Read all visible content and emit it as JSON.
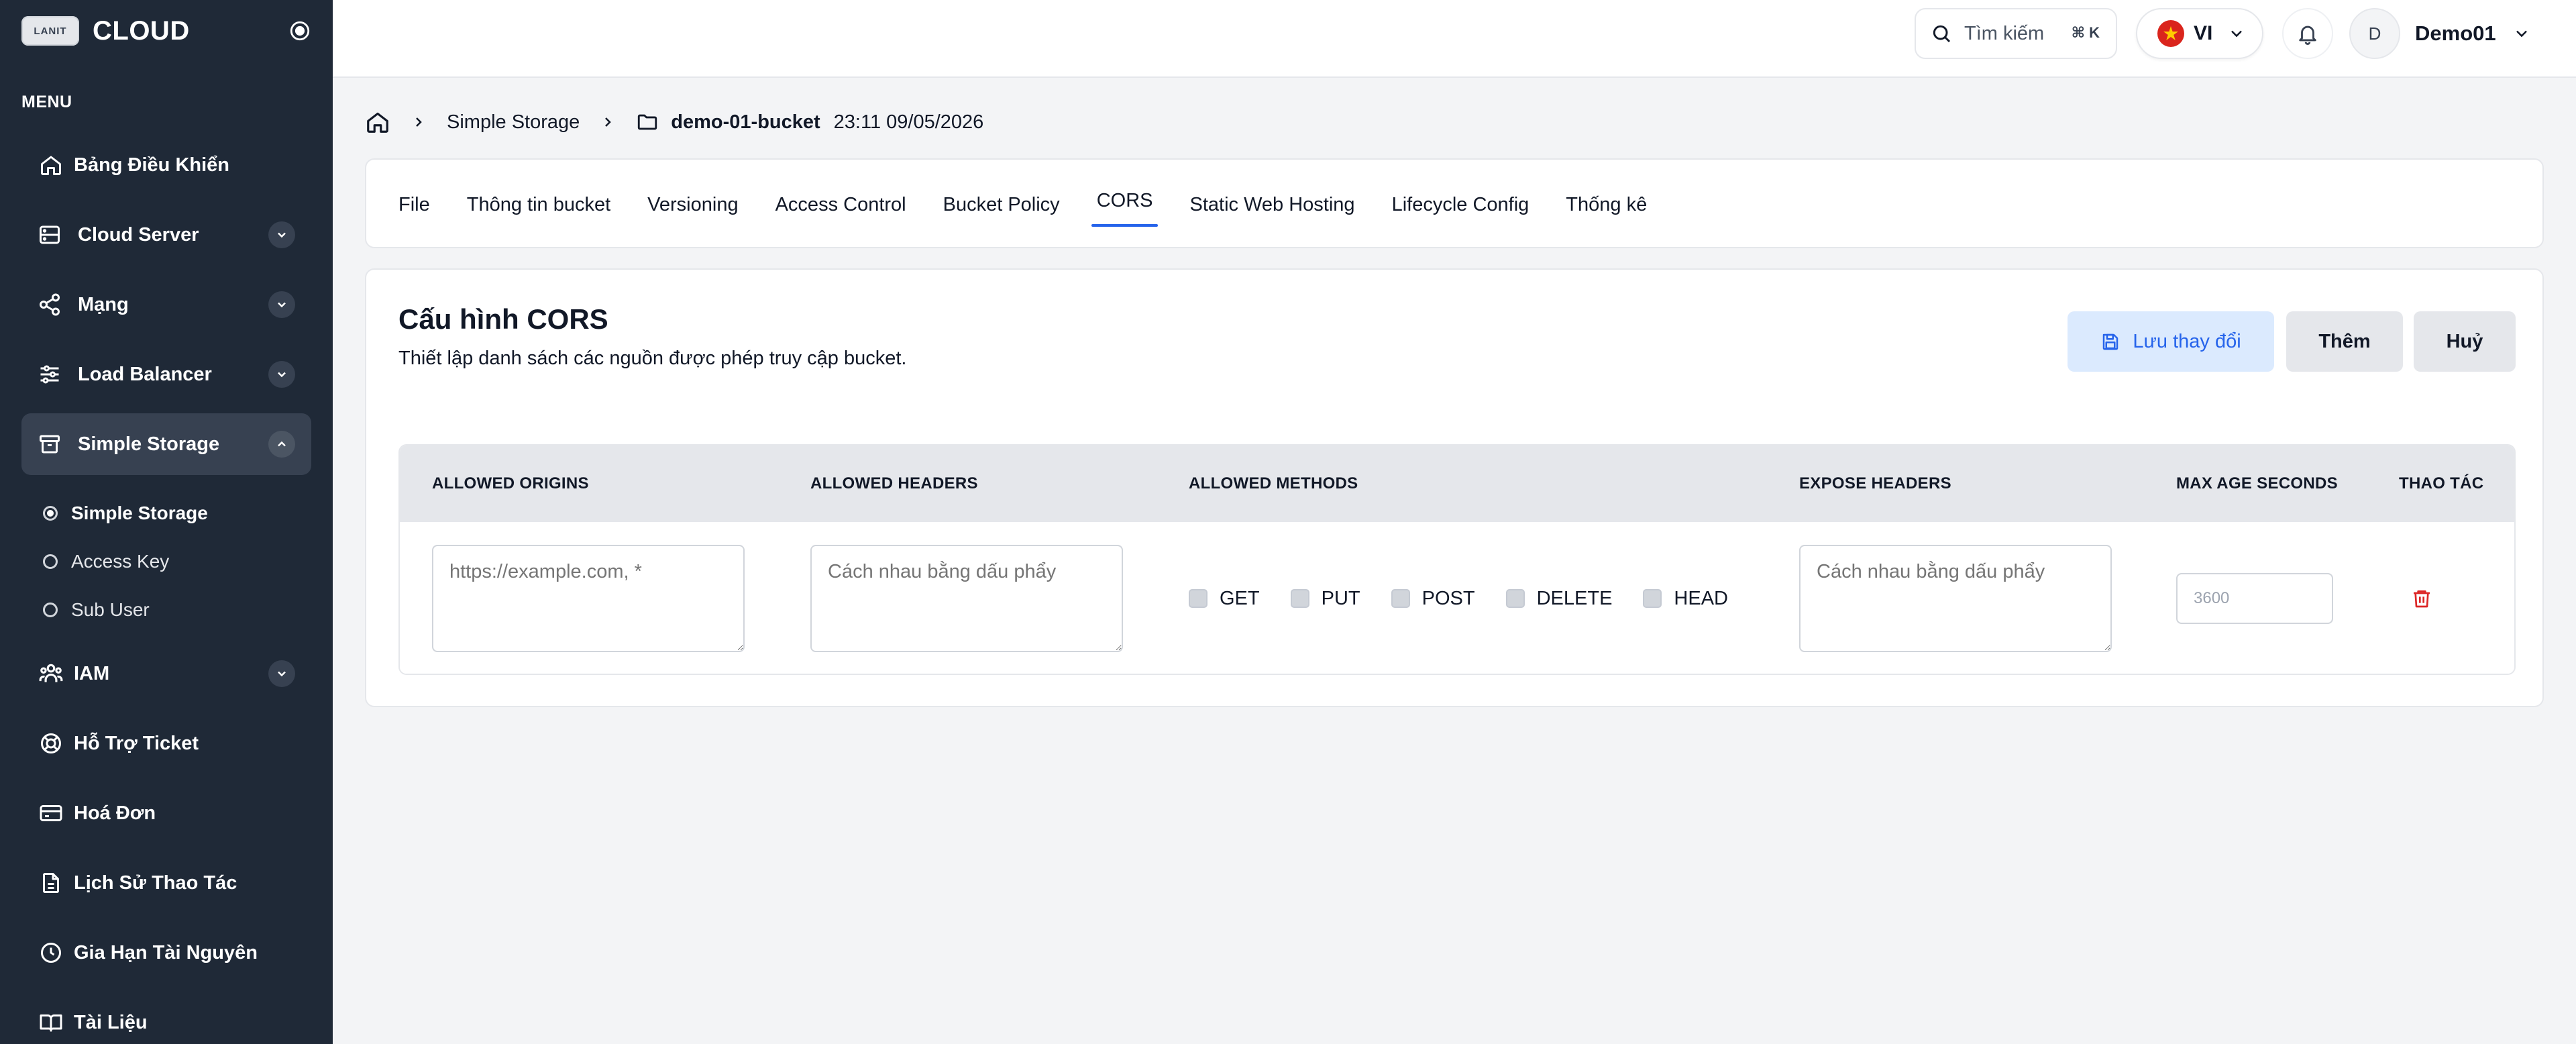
{
  "brand": {
    "logo_text": "LANIT",
    "name": "CLOUD"
  },
  "sidebar": {
    "menu_heading": "MENU",
    "items": [
      {
        "label": "Bảng Điều Khiển",
        "icon": "home-icon"
      },
      {
        "label": "Cloud Server",
        "icon": "server-icon",
        "expandable": true
      },
      {
        "label": "Mạng",
        "icon": "network-share-icon",
        "expandable": true
      },
      {
        "label": "Load Balancer",
        "icon": "sliders-icon",
        "expandable": true
      },
      {
        "label": "Simple Storage",
        "icon": "archive-box-icon",
        "expandable": true,
        "expanded": true,
        "active": true
      },
      {
        "label": "IAM",
        "icon": "users-group-icon",
        "expandable": true
      },
      {
        "label": "Hỗ Trợ Ticket",
        "icon": "lifebuoy-icon"
      },
      {
        "label": "Hoá Đơn",
        "icon": "credit-card-icon"
      },
      {
        "label": "Lịch Sử Thao Tác",
        "icon": "document-icon"
      },
      {
        "label": "Gia Hạn Tài Nguyên",
        "icon": "clock-icon"
      },
      {
        "label": "Tài Liệu",
        "icon": "book-icon"
      }
    ],
    "storage_subitems": [
      {
        "label": "Simple Storage",
        "active": true
      },
      {
        "label": "Access Key",
        "active": false
      },
      {
        "label": "Sub User",
        "active": false
      }
    ]
  },
  "header": {
    "search_placeholder": "Tìm kiếm",
    "search_shortcut": "⌘ K",
    "language": "VI",
    "user_initial": "D",
    "user_name": "Demo01"
  },
  "breadcrumb": {
    "parent": "Simple Storage",
    "bucket": "demo-01-bucket",
    "timestamp": "23:11 09/05/2026"
  },
  "tabs": [
    {
      "label": "File",
      "active": false
    },
    {
      "label": "Thông tin bucket",
      "active": false
    },
    {
      "label": "Versioning",
      "active": false
    },
    {
      "label": "Access Control",
      "active": false
    },
    {
      "label": "Bucket Policy",
      "active": false
    },
    {
      "label": "CORS",
      "active": true
    },
    {
      "label": "Static Web Hosting",
      "active": false
    },
    {
      "label": "Lifecycle Config",
      "active": false
    },
    {
      "label": "Thống kê",
      "active": false
    }
  ],
  "cors": {
    "title": "Cấu hình CORS",
    "subtitle": "Thiết lập danh sách các nguồn được phép truy cập bucket.",
    "save_label": "Lưu thay đổi",
    "add_label": "Thêm",
    "cancel_label": "Huỷ",
    "columns": {
      "origins": "ALLOWED ORIGINS",
      "headers": "ALLOWED HEADERS",
      "methods": "ALLOWED METHODS",
      "expose": "EXPOSE HEADERS",
      "max_age": "MAX AGE SECONDS",
      "actions": "THAO TÁC"
    },
    "rows": [
      {
        "origins_placeholder": "https://example.com, *",
        "headers_placeholder": "Cách nhau bằng dấu phẩy",
        "methods": [
          {
            "label": "GET",
            "checked": false
          },
          {
            "label": "PUT",
            "checked": false
          },
          {
            "label": "POST",
            "checked": false
          },
          {
            "label": "DELETE",
            "checked": false
          },
          {
            "label": "HEAD",
            "checked": false
          }
        ],
        "expose_placeholder": "Cách nhau bằng dấu phẩy",
        "max_age_placeholder": "3600"
      }
    ]
  },
  "colors": {
    "sidebar_bg": "#1f2937",
    "sidebar_active": "#374151",
    "accent": "#2563eb",
    "save_bg": "#dbeafe",
    "danger": "#dc2626"
  }
}
